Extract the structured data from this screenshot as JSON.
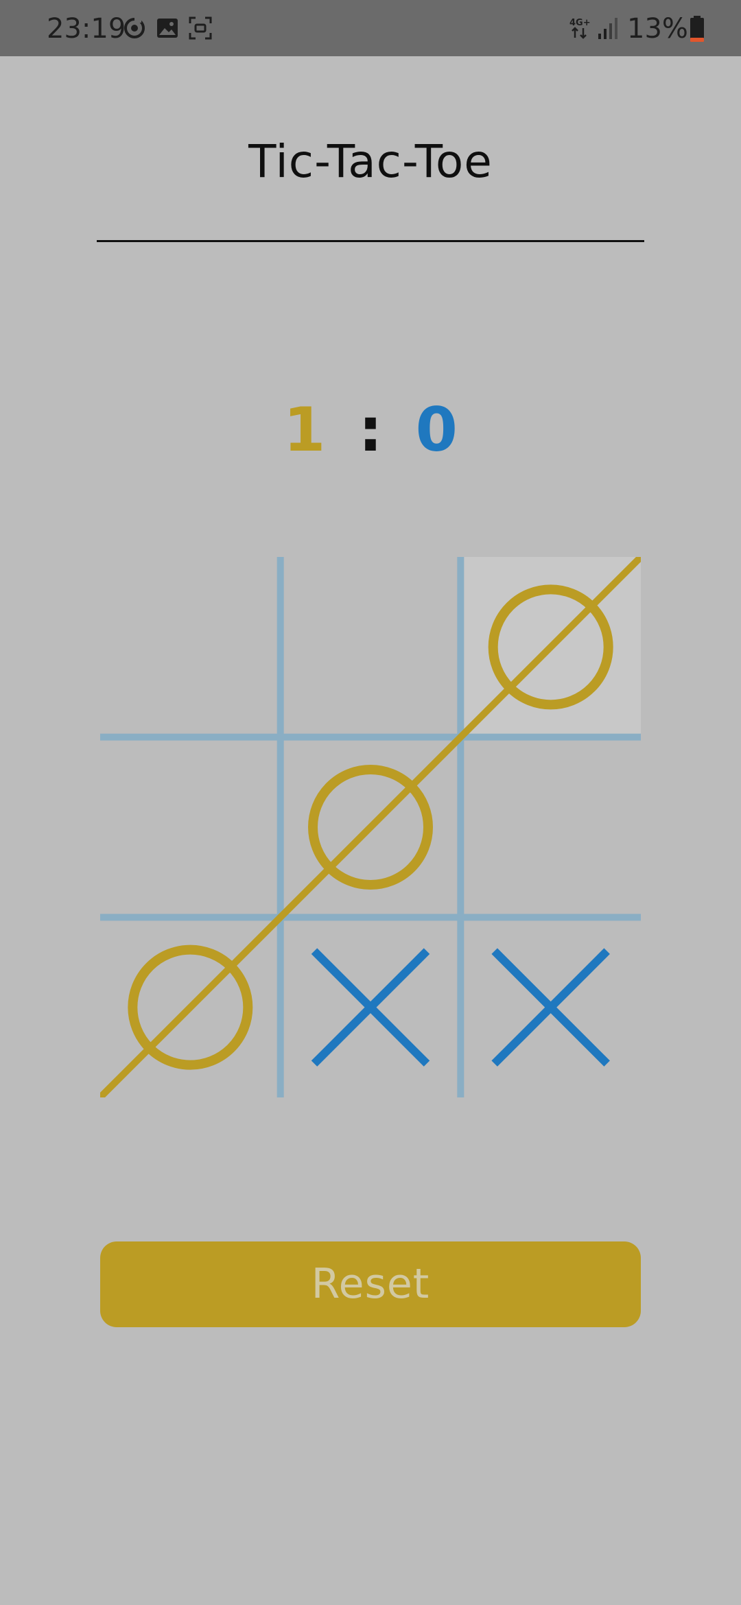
{
  "status_bar": {
    "time": "23:19",
    "icons": [
      "sync-icon",
      "gallery-icon",
      "screenshot-icon"
    ],
    "network_label": "4G+",
    "battery_percent": "13%"
  },
  "game": {
    "title": "Tic-Tac-Toe",
    "score": {
      "o": "1",
      "separator": ":",
      "x": "0"
    },
    "board": [
      [
        "",
        "",
        "O"
      ],
      [
        "",
        "O",
        ""
      ],
      [
        "O",
        "X",
        "X"
      ]
    ],
    "highlighted_cell": [
      0,
      2
    ],
    "winning_line": "anti-diagonal",
    "winner": "O",
    "reset_label": "Reset"
  },
  "colors": {
    "o": "#bb9c24",
    "x": "#1f78bf",
    "grid": "#8aaec4",
    "background": "#bcbcbc",
    "status_bar": "#6b6b6b",
    "highlight": "#c8c8c8"
  }
}
